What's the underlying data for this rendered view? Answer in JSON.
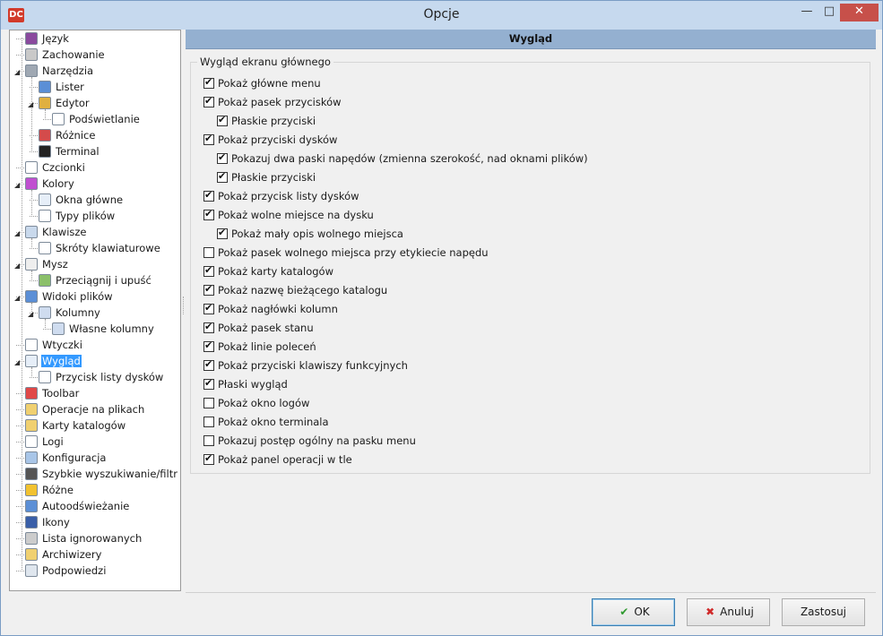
{
  "window": {
    "title": "Opcje",
    "app_icon_text": "DC"
  },
  "tree": {
    "items": [
      {
        "label": "Język",
        "icon": "language-icon",
        "color": "#8a4a9e"
      },
      {
        "label": "Zachowanie",
        "icon": "lock-icon",
        "color": "#c9c9c9"
      },
      {
        "label": "Narzędzia",
        "icon": "tools-icon",
        "color": "#9fa8b3"
      },
      {
        "label": "Lister",
        "icon": "book-icon",
        "color": "#5b8fd6"
      },
      {
        "label": "Edytor",
        "icon": "pencil-icon",
        "color": "#e0b040"
      },
      {
        "label": "Podświetlanie",
        "icon": "document-icon",
        "color": "#ffffff"
      },
      {
        "label": "Różnice",
        "icon": "diff-icon",
        "color": "#d44b4b"
      },
      {
        "label": "Terminal",
        "icon": "terminal-icon",
        "color": "#222222"
      },
      {
        "label": "Czcionki",
        "icon": "font-icon",
        "color": "#ffffff"
      },
      {
        "label": "Kolory",
        "icon": "color-wheel-icon",
        "color": "#c050d0"
      },
      {
        "label": "Okna główne",
        "icon": "window-layout-icon",
        "color": "#e6eef8"
      },
      {
        "label": "Typy plików",
        "icon": "file-types-icon",
        "color": "#ffffff"
      },
      {
        "label": "Klawisze",
        "icon": "keyboard-icon",
        "color": "#c9d9ec"
      },
      {
        "label": "Skróty klawiaturowe",
        "icon": "shortcut-icon",
        "color": "#ffffff"
      },
      {
        "label": "Mysz",
        "icon": "mouse-icon",
        "color": "#eeeeee"
      },
      {
        "label": "Przeciągnij i upuść",
        "icon": "drag-drop-icon",
        "color": "#8bc06a"
      },
      {
        "label": "Widoki plików",
        "icon": "file-view-icon",
        "color": "#5b8fd6"
      },
      {
        "label": "Kolumny",
        "icon": "columns-icon",
        "color": "#cfdcef"
      },
      {
        "label": "Własne kolumny",
        "icon": "custom-columns-icon",
        "color": "#cfdcef"
      },
      {
        "label": "Wtyczki",
        "icon": "plugin-icon",
        "color": "#ffffff"
      },
      {
        "label": "Wygląd",
        "icon": "layout-icon",
        "color": "#e6eef8"
      },
      {
        "label": "Przycisk listy dysków",
        "icon": "drive-button-icon",
        "color": "#ffffff"
      },
      {
        "label": "Toolbar",
        "icon": "scissors-icon",
        "color": "#e04848"
      },
      {
        "label": "Operacje na plikach",
        "icon": "file-operations-icon",
        "color": "#f0d070"
      },
      {
        "label": "Karty katalogów",
        "icon": "folder-tabs-icon",
        "color": "#f0d070"
      },
      {
        "label": "Logi",
        "icon": "log-icon",
        "color": "#ffffff"
      },
      {
        "label": "Konfiguracja",
        "icon": "config-icon",
        "color": "#a9c6e8"
      },
      {
        "label": "Szybkie wyszukiwanie/filtr",
        "icon": "binoculars-icon",
        "color": "#555555"
      },
      {
        "label": "Różne",
        "icon": "misc-icon",
        "color": "#f2c230"
      },
      {
        "label": "Autoodświeżanie",
        "icon": "refresh-icon",
        "color": "#5b8fd6"
      },
      {
        "label": "Ikony",
        "icon": "footprints-icon",
        "color": "#3a5fa8"
      },
      {
        "label": "Lista ignorowanych",
        "icon": "ignore-list-icon",
        "color": "#cccccc"
      },
      {
        "label": "Archiwizery",
        "icon": "archive-icon",
        "color": "#f0d070"
      },
      {
        "label": "Podpowiedzi",
        "icon": "lightbulb-icon",
        "color": "#dfe6ee"
      }
    ],
    "selected": "Wygląd"
  },
  "main": {
    "title": "Wygląd",
    "group_title": "Wygląd ekranu głównego",
    "options": [
      {
        "label": "Pokaż główne menu",
        "checked": true
      },
      {
        "label": "Pokaż pasek przycisków",
        "checked": true
      },
      {
        "label": "Płaskie przyciski",
        "checked": true
      },
      {
        "label": "Pokaż przyciski dysków",
        "checked": true
      },
      {
        "label": "Pokazuj dwa paski napędów (zmienna szerokość, nad oknami plików)",
        "checked": true
      },
      {
        "label": "Płaskie przyciski",
        "checked": true
      },
      {
        "label": "Pokaż przycisk listy dysków",
        "checked": true
      },
      {
        "label": "Pokaż wolne miejsce na dysku",
        "checked": true
      },
      {
        "label": "Pokaż mały opis wolnego miejsca",
        "checked": true
      },
      {
        "label": "Pokaż pasek wolnego miejsca przy etykiecie napędu",
        "checked": false
      },
      {
        "label": "Pokaż karty katalogów",
        "checked": true
      },
      {
        "label": "Pokaż nazwę bieżącego katalogu",
        "checked": true
      },
      {
        "label": "Pokaż nagłówki kolumn",
        "checked": true
      },
      {
        "label": "Pokaż pasek stanu",
        "checked": true
      },
      {
        "label": "Pokaż linie poleceń",
        "checked": true
      },
      {
        "label": "Pokaż przyciski klawiszy funkcyjnych",
        "checked": true
      },
      {
        "label": "Płaski wygląd",
        "checked": true
      },
      {
        "label": "Pokaż okno logów",
        "checked": false
      },
      {
        "label": "Pokaż okno terminala",
        "checked": false
      },
      {
        "label": "Pokazuj postęp ogólny na pasku menu",
        "checked": false
      },
      {
        "label": "Pokaż panel operacji w tle",
        "checked": true
      }
    ]
  },
  "buttons": {
    "ok": "OK",
    "cancel": "Anuluj",
    "apply": "Zastosuj"
  }
}
